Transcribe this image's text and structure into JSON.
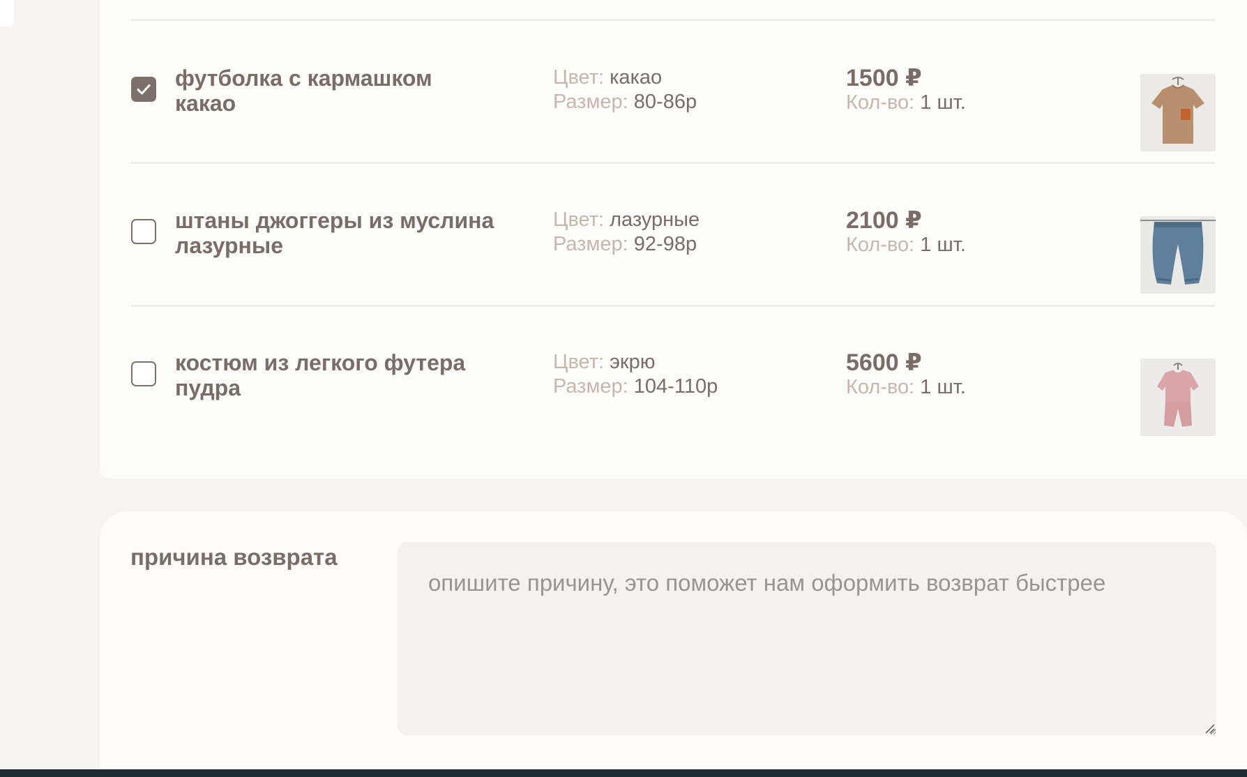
{
  "items": [
    {
      "name": "футболка с кармашком какао",
      "checked": true,
      "color_label": "Цвет:",
      "color_value": "какао",
      "size_label": "Размер:",
      "size_value": "80-86р",
      "price": "1500 ₽",
      "qty_label": "Кол-во:",
      "qty_value": "1 шт.",
      "image_icon": "tshirt-cocoa"
    },
    {
      "name": "штаны джоггеры из муслина лазурные",
      "checked": false,
      "color_label": "Цвет:",
      "color_value": "лазурные",
      "size_label": "Размер:",
      "size_value": "92-98р",
      "price": "2100 ₽",
      "qty_label": "Кол-во:",
      "qty_value": "1 шт.",
      "image_icon": "jogger-pants-azure"
    },
    {
      "name": "костюм из легкого футера пудра",
      "checked": false,
      "color_label": "Цвет:",
      "color_value": "экрю",
      "size_label": "Размер:",
      "size_value": "104-110р",
      "price": "5600 ₽",
      "qty_label": "Кол-во:",
      "qty_value": "1 шт.",
      "image_icon": "suit-powder-pink"
    }
  ],
  "reason": {
    "label": "причина возврата",
    "placeholder": "опишите причину, это поможет нам оформить возврат быстрее",
    "value": ""
  },
  "colors": {
    "text": "#7a6c67",
    "muted_label": "#c7b6ac",
    "checkbox_fill": "#7c706b",
    "page_bg": "#f5f4f2",
    "card_bg": "#fcfcfb"
  }
}
